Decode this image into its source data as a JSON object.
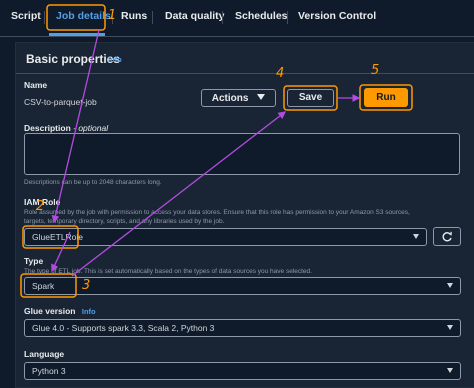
{
  "tabs": [
    {
      "label": "Script"
    },
    {
      "label": "Job details"
    },
    {
      "label": "Runs"
    },
    {
      "label": "Data quality"
    },
    {
      "label": "Schedules"
    },
    {
      "label": "Version Control"
    }
  ],
  "panel": {
    "title": "Basic properties",
    "info": "Info"
  },
  "name": {
    "label": "Name",
    "value": "CSV-to-parquet-job"
  },
  "buttons": {
    "actions": "Actions",
    "save": "Save",
    "run": "Run"
  },
  "description": {
    "label": "Description",
    "optional": "- optional",
    "hint": "Descriptions can be up to 2048 characters long.",
    "value": ""
  },
  "iam_role": {
    "label": "IAM Role",
    "hint_line1": "Role assumed by the job with permission to access your data stores. Ensure that this role has permission to your Amazon S3 sources,",
    "hint_line2": "targets, temporary directory, scripts, and any libraries used by the job.",
    "value": "GlueETLRole"
  },
  "type": {
    "label": "Type",
    "hint": "The type of ETL job. This is set automatically based on the types of data sources you have selected.",
    "value": "Spark"
  },
  "glue_version": {
    "label": "Glue version",
    "info": "Info",
    "value": "Glue 4.0 - Supports spark 3.3, Scala 2, Python 3"
  },
  "language": {
    "label": "Language",
    "value": "Python 3"
  },
  "annotations": [
    "1",
    "2",
    "3",
    "4",
    "5"
  ],
  "colors": {
    "accent": "#ff9900",
    "arrow": "#b44be1",
    "link": "#539fe5"
  }
}
